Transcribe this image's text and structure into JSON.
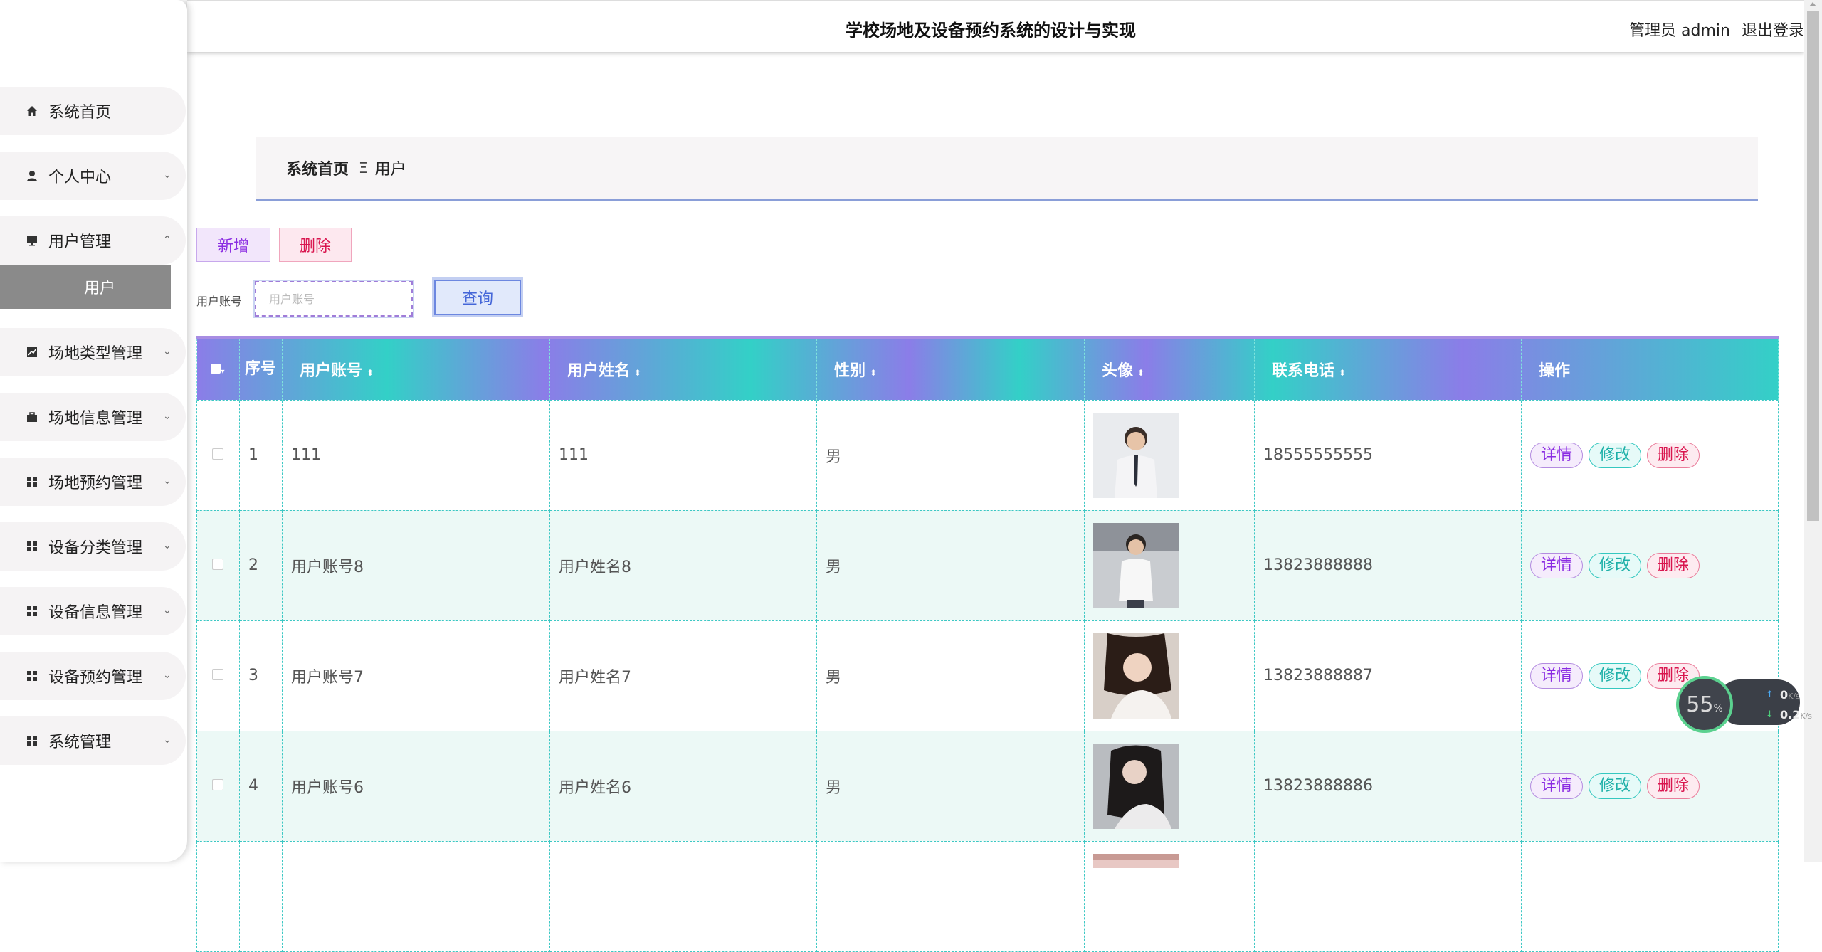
{
  "header": {
    "title": "学校场地及设备预约系统的设计与实现",
    "role": "管理员",
    "username": "admin",
    "logout": "退出登录"
  },
  "sidebar": {
    "items": [
      {
        "label": "系统首页",
        "icon": "home-icon"
      },
      {
        "label": "个人中心",
        "icon": "user-icon"
      },
      {
        "label": "用户管理",
        "icon": "monitor-icon",
        "expanded": true
      },
      {
        "label": "场地类型管理",
        "icon": "chart-icon"
      },
      {
        "label": "场地信息管理",
        "icon": "briefcase-icon"
      },
      {
        "label": "场地预约管理",
        "icon": "grid-icon"
      },
      {
        "label": "设备分类管理",
        "icon": "grid-icon"
      },
      {
        "label": "设备信息管理",
        "icon": "grid-icon"
      },
      {
        "label": "设备预约管理",
        "icon": "grid-icon"
      },
      {
        "label": "系统管理",
        "icon": "grid-icon"
      }
    ],
    "submenu_active": "用户"
  },
  "breadcrumb": {
    "home": "系统首页",
    "separator": "Ξ",
    "current": "用户"
  },
  "actions": {
    "add": "新增",
    "delete": "删除"
  },
  "search": {
    "label": "用户账号",
    "placeholder": "用户账号",
    "button": "查询"
  },
  "table": {
    "columns": [
      "序号",
      "用户账号",
      "用户姓名",
      "性别",
      "头像",
      "联系电话",
      "操作"
    ],
    "rows": [
      {
        "idx": "1",
        "account": "111",
        "name": "111",
        "gender": "男",
        "phone": "18555555555"
      },
      {
        "idx": "2",
        "account": "用户账号8",
        "name": "用户姓名8",
        "gender": "男",
        "phone": "13823888888"
      },
      {
        "idx": "3",
        "account": "用户账号7",
        "name": "用户姓名7",
        "gender": "男",
        "phone": "13823888887"
      },
      {
        "idx": "4",
        "account": "用户账号6",
        "name": "用户姓名6",
        "gender": "男",
        "phone": "13823888886"
      },
      {
        "idx": "",
        "account": "",
        "name": "",
        "gender": "",
        "phone": ""
      }
    ],
    "ops": {
      "detail": "详情",
      "edit": "修改",
      "delete": "删除"
    }
  },
  "net_widget": {
    "percent": "55",
    "percent_unit": "%",
    "up_value": "0",
    "down_value": "0.2",
    "unit": "K/s"
  }
}
